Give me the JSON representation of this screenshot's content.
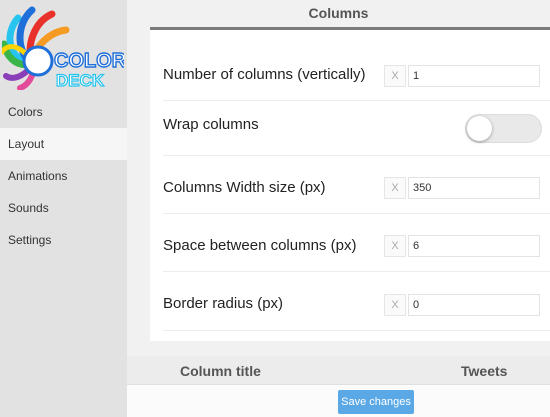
{
  "logo": {
    "line1": "COLOR",
    "line2": "DECK",
    "colors": {
      "blue": "#1e6fd9",
      "cyan": "#27c4f0",
      "red": "#e8312b",
      "orange": "#f59a23",
      "yellow": "#ffd400",
      "green": "#3bb54a",
      "purple": "#8a3fb8",
      "pink": "#e34a9a"
    }
  },
  "sidebar": {
    "items": [
      {
        "label": "Colors"
      },
      {
        "label": "Layout",
        "active": true
      },
      {
        "label": "Animations"
      },
      {
        "label": "Sounds"
      },
      {
        "label": "Settings"
      }
    ]
  },
  "main": {
    "title": "Columns",
    "settings": [
      {
        "label": "Number of columns (vertically)",
        "clear": "X",
        "value": "1"
      },
      {
        "label": "Wrap columns",
        "toggle": false
      },
      {
        "label": "Columns Width size (px)",
        "clear": "X",
        "value": "350"
      },
      {
        "label": "Space between columns (px)",
        "clear": "X",
        "value": "6"
      },
      {
        "label": "Border radius (px)",
        "clear": "X",
        "value": "0"
      }
    ],
    "table_headers": [
      "Column title",
      "Tweets"
    ],
    "save_label": "Save changes"
  },
  "colors": {
    "accent": "#5aa9e6",
    "sidebar_bg": "#e2e2e2",
    "rule": "#7a7a7a"
  }
}
